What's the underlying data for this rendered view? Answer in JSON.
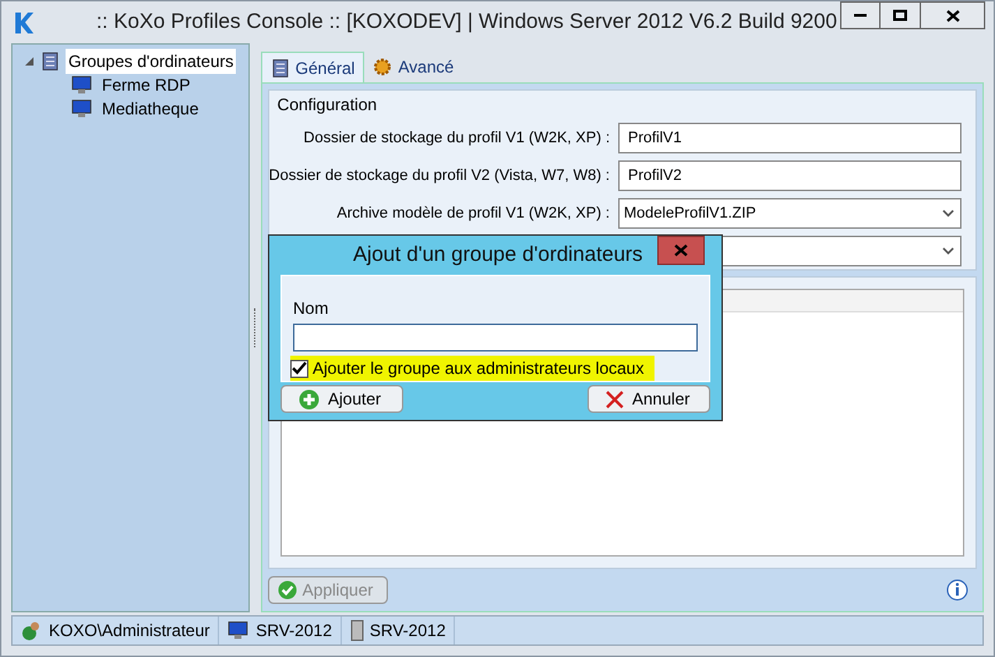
{
  "window": {
    "title": ":: KoXo Profiles Console :: [KOXODEV]  | Windows Server 2012 V6.2 Build 9200"
  },
  "tree": [
    {
      "label": "Groupes d'ordinateurs",
      "selected": true,
      "expanded": true,
      "children": [
        {
          "label": "Ferme RDP",
          "selected": false
        },
        {
          "label": "Mediatheque",
          "selected": false
        }
      ]
    }
  ],
  "tabs": [
    {
      "label": "Général",
      "selected": true
    },
    {
      "label": "Avancé",
      "selected": false
    }
  ],
  "configuration": {
    "title": "Configuration",
    "fields": [
      {
        "kind": "text",
        "label": "Dossier de stockage du profil V1 (W2K, XP) :",
        "value": "ProfilV1"
      },
      {
        "kind": "text",
        "label": "Dossier de stockage du profil V2 (Vista, W7, W8) :",
        "value": "ProfilV2"
      },
      {
        "kind": "select",
        "label": "Archive modèle de profil V1 (W2K, XP) :",
        "value": "ModeleProfilV1.ZIP"
      },
      {
        "kind": "select"
      }
    ]
  },
  "apply_button": {
    "label": "Appliquer",
    "disabled": true
  },
  "dialog": {
    "title": "Ajout d'un groupe d'ordinateurs",
    "name_label": "Nom",
    "checkbox": {
      "label": "Ajouter le groupe aux administrateurs locaux",
      "checked": true
    },
    "buttons": [
      {
        "kind": "add",
        "label": "Ajouter"
      },
      {
        "kind": "cancel",
        "label": "Annuler"
      }
    ]
  },
  "status_bar": [
    {
      "kind": "user",
      "text": "KOXO\\Administrateur"
    },
    {
      "kind": "computer",
      "text": "SRV-2012"
    },
    {
      "kind": "server",
      "text": "SRV-2012"
    }
  ]
}
